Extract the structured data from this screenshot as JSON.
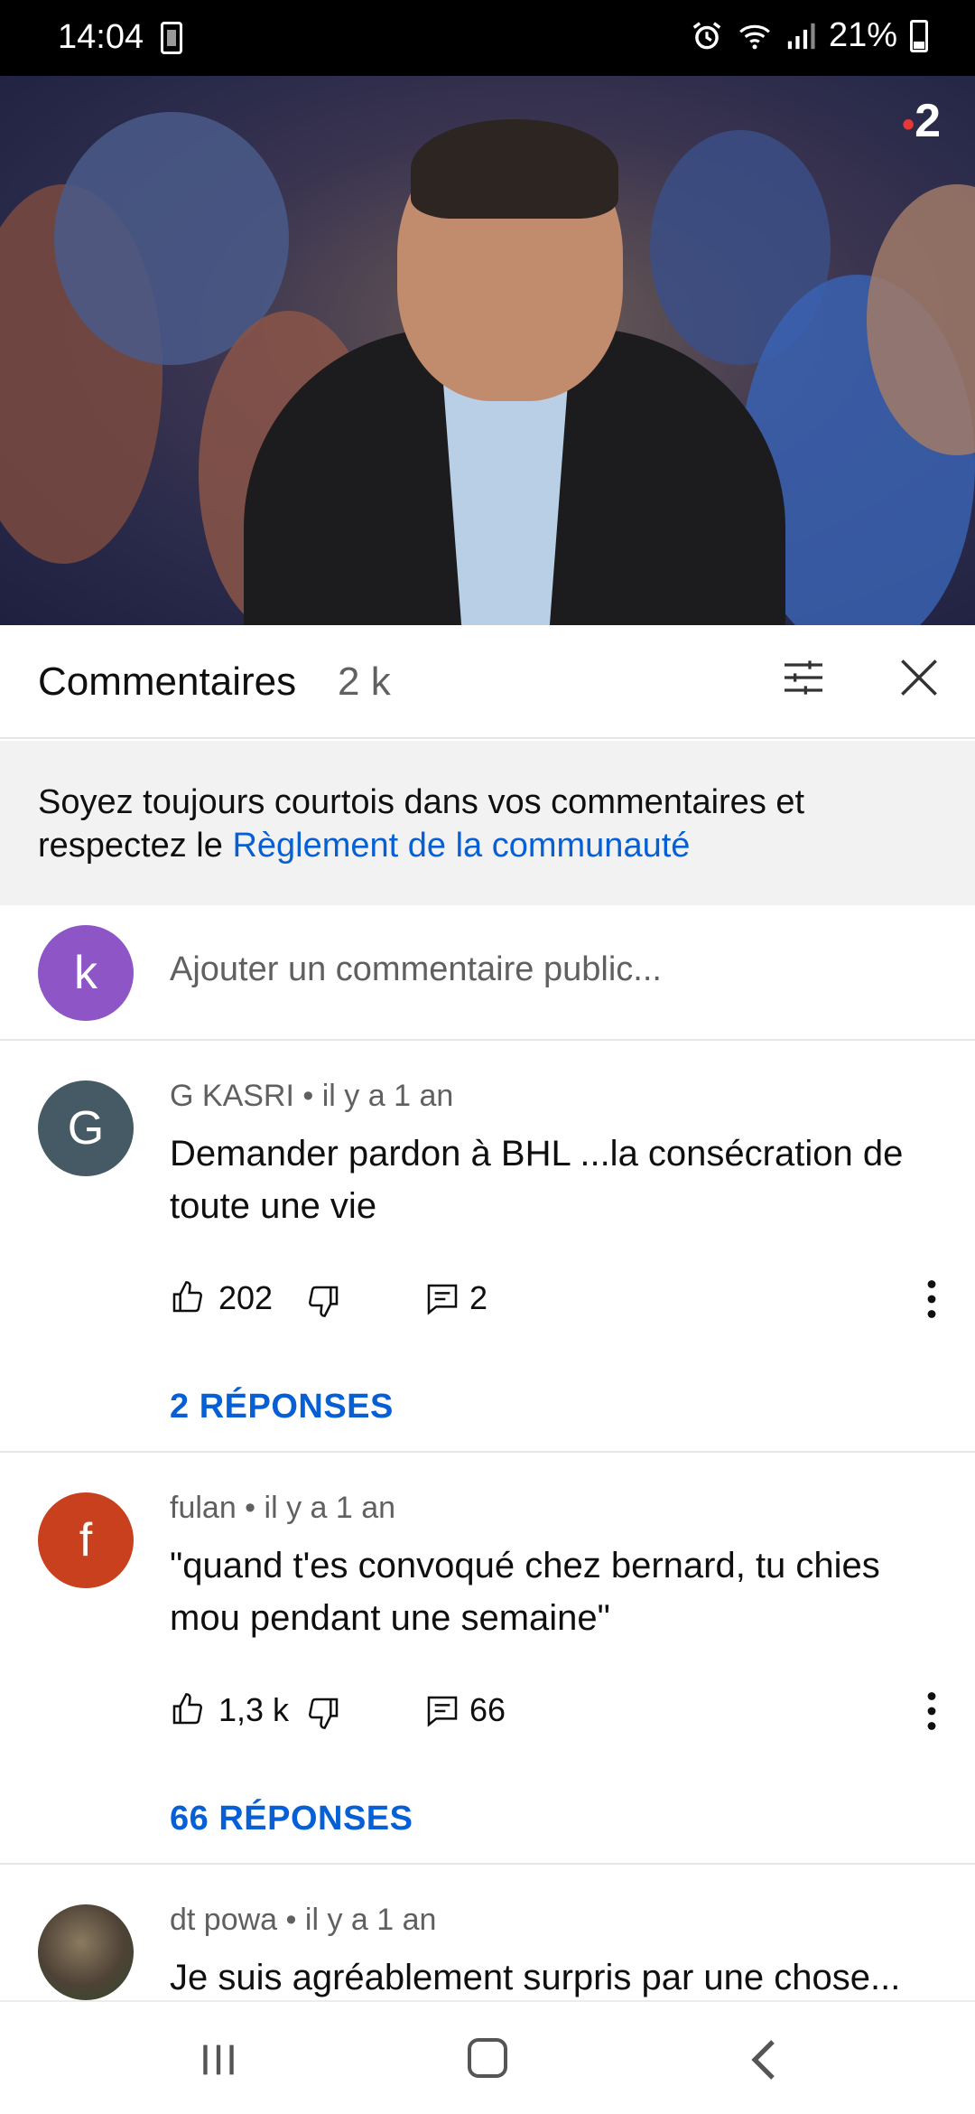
{
  "status_bar": {
    "time": "14:04",
    "battery": "21%"
  },
  "video": {
    "channel_logo": "2",
    "progress_played_fraction": 0.11,
    "progress_buffered_fraction": 0.37
  },
  "header": {
    "title": "Commentaires",
    "count": "2 k",
    "filter_icon": "sliders-icon",
    "close_icon": "close-icon"
  },
  "notice": {
    "text": "Soyez toujours courtois dans vos commentaires et respectez le ",
    "link": "Règlement de la communauté"
  },
  "add_comment": {
    "avatar_letter": "k",
    "avatar_color": "#8e55c7",
    "placeholder": "Ajouter un commentaire public..."
  },
  "comments": [
    {
      "avatar_letter": "G",
      "avatar_color": "#455a64",
      "author": "G KASRI",
      "time": "il y a 1 an",
      "text": "Demander pardon à BHL ...la consécration de toute une vie",
      "likes": "202",
      "replies_count": "2",
      "replies_link": "2 RÉPONSES"
    },
    {
      "avatar_letter": "f",
      "avatar_color": "#c8401d",
      "author": "fulan",
      "time": "il y a 1 an",
      "text": "\"quand t'es convoqué chez bernard, tu chies mou pendant une semaine\"",
      "likes": "1,3 k",
      "replies_count": "66",
      "replies_link": "66 RÉPONSES"
    },
    {
      "avatar_letter": "",
      "avatar_color": "#6b5b45",
      "author": "dt powa",
      "time": "il y a 1 an",
      "text": "Je suis agréablement surpris par une chose..."
    }
  ],
  "meta_separator": " • ",
  "colors": {
    "accent_link": "#065fd4",
    "progress_red": "#ee0000"
  }
}
